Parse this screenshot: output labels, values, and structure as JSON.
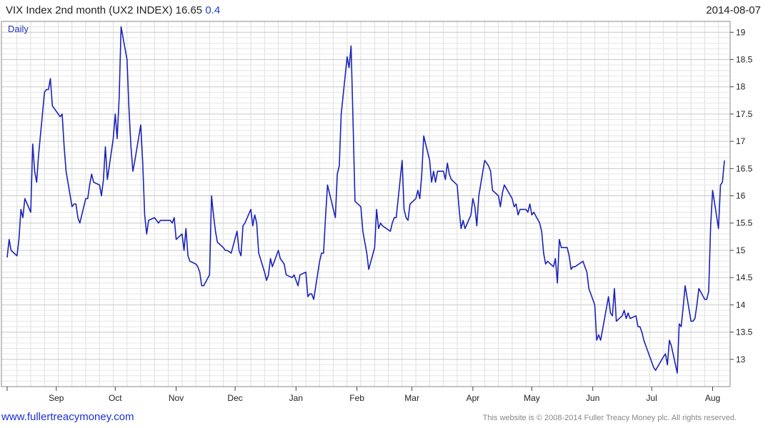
{
  "header": {
    "title": "VIX Index 2nd month (UX2 INDEX) 16.65",
    "change": "0.4",
    "date": "2014-08-07"
  },
  "footer": {
    "website": "www.fullertreacymoney.com",
    "copyright": "This website is © 2008-2014 Fuller Treacy Money plc. All rights reserved."
  },
  "chart_data": {
    "type": "line",
    "frequency_label": "Daily",
    "ylim": [
      12.5,
      19.2
    ],
    "y_ticks": [
      13,
      13.5,
      14,
      14.5,
      15,
      15.5,
      16,
      16.5,
      17,
      17.5,
      18,
      18.5,
      19
    ],
    "y_tick_labels": [
      "13",
      "13.5",
      "14",
      "14.5",
      "15",
      "15.5",
      "16",
      "16.5",
      "17",
      "17.5",
      "18",
      "18.5",
      "19"
    ],
    "x_start": "2013-08-07",
    "x_end": "2014-08-07",
    "x_ticks": [
      "2013-09-01",
      "2013-10-01",
      "2013-11-01",
      "2013-12-01",
      "2014-01-01",
      "2014-02-01",
      "2014-03-01",
      "2014-04-01",
      "2014-05-01",
      "2014-06-01",
      "2014-07-01",
      "2014-08-01"
    ],
    "x_tick_labels": [
      "Sep",
      "Oct",
      "Nov",
      "Dec",
      "Jan",
      "Feb",
      "Mar",
      "Apr",
      "May",
      "Jun",
      "Jul",
      "Aug"
    ],
    "grid": true,
    "line_color": "#1a23b8",
    "series": [
      {
        "x": [
          "2013-08-07",
          "2013-08-08",
          "2013-08-09",
          "2013-08-12",
          "2013-08-13",
          "2013-08-14",
          "2013-08-15",
          "2013-08-16",
          "2013-08-19",
          "2013-08-20",
          "2013-08-21",
          "2013-08-22",
          "2013-08-23",
          "2013-08-26",
          "2013-08-27",
          "2013-08-28",
          "2013-08-29",
          "2013-08-30",
          "2013-09-03",
          "2013-09-04",
          "2013-09-05",
          "2013-09-06",
          "2013-09-09",
          "2013-09-10",
          "2013-09-11",
          "2013-09-12",
          "2013-09-13",
          "2013-09-16",
          "2013-09-17",
          "2013-09-18",
          "2013-09-19",
          "2013-09-20",
          "2013-09-23",
          "2013-09-24",
          "2013-09-25",
          "2013-09-26",
          "2013-09-27",
          "2013-09-30",
          "2013-10-01",
          "2013-10-02",
          "2013-10-03",
          "2013-10-04",
          "2013-10-07",
          "2013-10-08",
          "2013-10-09",
          "2013-10-10",
          "2013-10-11",
          "2013-10-14",
          "2013-10-15",
          "2013-10-16",
          "2013-10-17",
          "2013-10-18",
          "2013-10-21",
          "2013-10-22",
          "2013-10-23",
          "2013-10-24",
          "2013-10-25",
          "2013-10-28",
          "2013-10-29",
          "2013-10-30",
          "2013-10-31",
          "2013-11-01",
          "2013-11-04",
          "2013-11-05",
          "2013-11-06",
          "2013-11-07",
          "2013-11-08",
          "2013-11-11",
          "2013-11-12",
          "2013-11-13",
          "2013-11-14",
          "2013-11-15",
          "2013-11-18",
          "2013-11-19",
          "2013-11-20",
          "2013-11-21",
          "2013-11-22",
          "2013-11-25",
          "2013-11-26",
          "2013-11-27",
          "2013-11-29",
          "2013-12-02",
          "2013-12-03",
          "2013-12-04",
          "2013-12-05",
          "2013-12-06",
          "2013-12-09",
          "2013-12-10",
          "2013-12-11",
          "2013-12-12",
          "2013-12-13",
          "2013-12-16",
          "2013-12-17",
          "2013-12-18",
          "2013-12-19",
          "2013-12-20",
          "2013-12-23",
          "2013-12-24",
          "2013-12-26",
          "2013-12-27",
          "2013-12-30",
          "2013-12-31",
          "2014-01-02",
          "2014-01-03",
          "2014-01-06",
          "2014-01-07",
          "2014-01-08",
          "2014-01-09",
          "2014-01-10",
          "2014-01-13",
          "2014-01-14",
          "2014-01-15",
          "2014-01-16",
          "2014-01-17",
          "2014-01-21",
          "2014-01-22",
          "2014-01-23",
          "2014-01-24",
          "2014-01-27",
          "2014-01-28",
          "2014-01-29",
          "2014-01-30",
          "2014-01-31",
          "2014-02-03",
          "2014-02-04",
          "2014-02-05",
          "2014-02-06",
          "2014-02-07",
          "2014-02-10",
          "2014-02-11",
          "2014-02-12",
          "2014-02-13",
          "2014-02-14",
          "2014-02-18",
          "2014-02-19",
          "2014-02-20",
          "2014-02-21",
          "2014-02-24",
          "2014-02-25",
          "2014-02-26",
          "2014-02-27",
          "2014-02-28",
          "2014-03-03",
          "2014-03-04",
          "2014-03-05",
          "2014-03-06",
          "2014-03-07",
          "2014-03-10",
          "2014-03-11",
          "2014-03-12",
          "2014-03-13",
          "2014-03-14",
          "2014-03-17",
          "2014-03-18",
          "2014-03-19",
          "2014-03-20",
          "2014-03-21",
          "2014-03-24",
          "2014-03-25",
          "2014-03-26",
          "2014-03-27",
          "2014-03-28",
          "2014-03-31",
          "2014-04-01",
          "2014-04-02",
          "2014-04-03",
          "2014-04-04",
          "2014-04-07",
          "2014-04-08",
          "2014-04-09",
          "2014-04-10",
          "2014-04-11",
          "2014-04-14",
          "2014-04-15",
          "2014-04-16",
          "2014-04-17",
          "2014-04-21",
          "2014-04-22",
          "2014-04-23",
          "2014-04-24",
          "2014-04-25",
          "2014-04-28",
          "2014-04-29",
          "2014-04-30",
          "2014-05-01",
          "2014-05-02",
          "2014-05-05",
          "2014-05-06",
          "2014-05-07",
          "2014-05-08",
          "2014-05-09",
          "2014-05-12",
          "2014-05-13",
          "2014-05-14",
          "2014-05-15",
          "2014-05-16",
          "2014-05-19",
          "2014-05-20",
          "2014-05-21",
          "2014-05-22",
          "2014-05-23",
          "2014-05-27",
          "2014-05-28",
          "2014-05-29",
          "2014-05-30",
          "2014-06-02",
          "2014-06-03",
          "2014-06-04",
          "2014-06-05",
          "2014-06-06",
          "2014-06-09",
          "2014-06-10",
          "2014-06-11",
          "2014-06-12",
          "2014-06-13",
          "2014-06-16",
          "2014-06-17",
          "2014-06-18",
          "2014-06-19",
          "2014-06-20",
          "2014-06-23",
          "2014-06-24",
          "2014-06-25",
          "2014-06-26",
          "2014-06-27",
          "2014-06-30",
          "2014-07-01",
          "2014-07-02",
          "2014-07-03",
          "2014-07-07",
          "2014-07-08",
          "2014-07-09",
          "2014-07-10",
          "2014-07-11",
          "2014-07-14",
          "2014-07-15",
          "2014-07-16",
          "2014-07-17",
          "2014-07-18",
          "2014-07-21",
          "2014-07-22",
          "2014-07-23",
          "2014-07-24",
          "2014-07-25",
          "2014-07-28",
          "2014-07-29",
          "2014-07-30",
          "2014-07-31",
          "2014-08-01",
          "2014-08-04",
          "2014-08-05",
          "2014-08-06",
          "2014-08-07"
        ],
        "values": [
          14.87,
          15.2,
          15.0,
          14.9,
          15.2,
          15.75,
          15.6,
          15.95,
          15.7,
          16.95,
          16.45,
          16.25,
          16.75,
          17.9,
          17.95,
          17.95,
          18.15,
          17.65,
          17.45,
          17.5,
          16.9,
          16.45,
          15.8,
          15.85,
          15.85,
          15.6,
          15.5,
          15.95,
          15.95,
          16.2,
          16.4,
          16.25,
          16.2,
          16.0,
          16.3,
          16.9,
          16.3,
          17.05,
          17.5,
          17.05,
          17.8,
          19.1,
          18.5,
          17.6,
          16.9,
          16.45,
          16.65,
          17.3,
          16.6,
          15.65,
          15.3,
          15.55,
          15.6,
          15.55,
          15.5,
          15.55,
          15.55,
          15.55,
          15.55,
          15.5,
          15.6,
          15.2,
          15.3,
          15.0,
          15.4,
          14.9,
          14.8,
          14.75,
          14.7,
          14.6,
          14.35,
          14.35,
          14.55,
          16.0,
          15.65,
          15.35,
          15.15,
          15.05,
          15.0,
          15.0,
          14.95,
          15.35,
          15.0,
          14.9,
          15.45,
          15.5,
          15.75,
          15.45,
          15.65,
          15.5,
          14.95,
          14.6,
          14.45,
          14.55,
          14.85,
          14.7,
          15.0,
          14.85,
          14.75,
          14.55,
          14.5,
          14.55,
          14.35,
          14.55,
          14.6,
          14.15,
          14.2,
          14.2,
          14.1,
          14.8,
          14.95,
          14.95,
          15.6,
          16.2,
          15.6,
          16.4,
          16.55,
          17.5,
          18.55,
          18.35,
          18.75,
          17.4,
          15.9,
          15.8,
          15.35,
          15.15,
          14.95,
          14.65,
          15.05,
          15.75,
          15.4,
          15.5,
          15.45,
          15.35,
          15.5,
          15.6,
          15.6,
          16.65,
          15.75,
          15.6,
          15.55,
          15.85,
          15.95,
          16.1,
          15.95,
          16.4,
          17.1,
          16.65,
          16.25,
          16.45,
          16.25,
          16.45,
          16.45,
          16.3,
          16.6,
          16.4,
          16.3,
          16.2,
          15.75,
          15.4,
          15.55,
          15.4,
          15.65,
          15.95,
          15.8,
          15.45,
          16.0,
          16.65,
          16.6,
          16.55,
          16.45,
          16.1,
          16.0,
          15.8,
          16.05,
          16.2,
          15.95,
          15.8,
          15.85,
          15.65,
          15.75,
          15.75,
          15.7,
          15.85,
          15.65,
          15.7,
          15.5,
          15.35,
          14.95,
          14.75,
          14.8,
          14.7,
          14.85,
          14.4,
          15.2,
          15.05,
          15.05,
          14.9,
          14.65,
          14.7,
          14.7,
          14.8,
          14.7,
          14.6,
          14.3,
          14.0,
          13.35,
          13.45,
          13.35,
          13.55,
          14.15,
          13.85,
          13.8,
          14.3,
          13.7,
          13.8,
          13.9,
          13.75,
          13.85,
          13.75,
          13.8,
          13.6,
          13.6,
          13.5,
          13.35,
          13.05,
          12.95,
          12.85,
          12.8,
          13.05,
          13.1,
          12.9,
          13.35,
          13.25,
          12.75,
          13.65,
          13.6,
          13.95,
          14.35,
          13.7,
          13.7,
          13.75,
          14.0,
          14.3,
          14.1,
          14.1,
          14.25,
          15.45,
          16.1,
          15.4,
          16.2,
          16.25,
          16.65
        ]
      }
    ]
  }
}
